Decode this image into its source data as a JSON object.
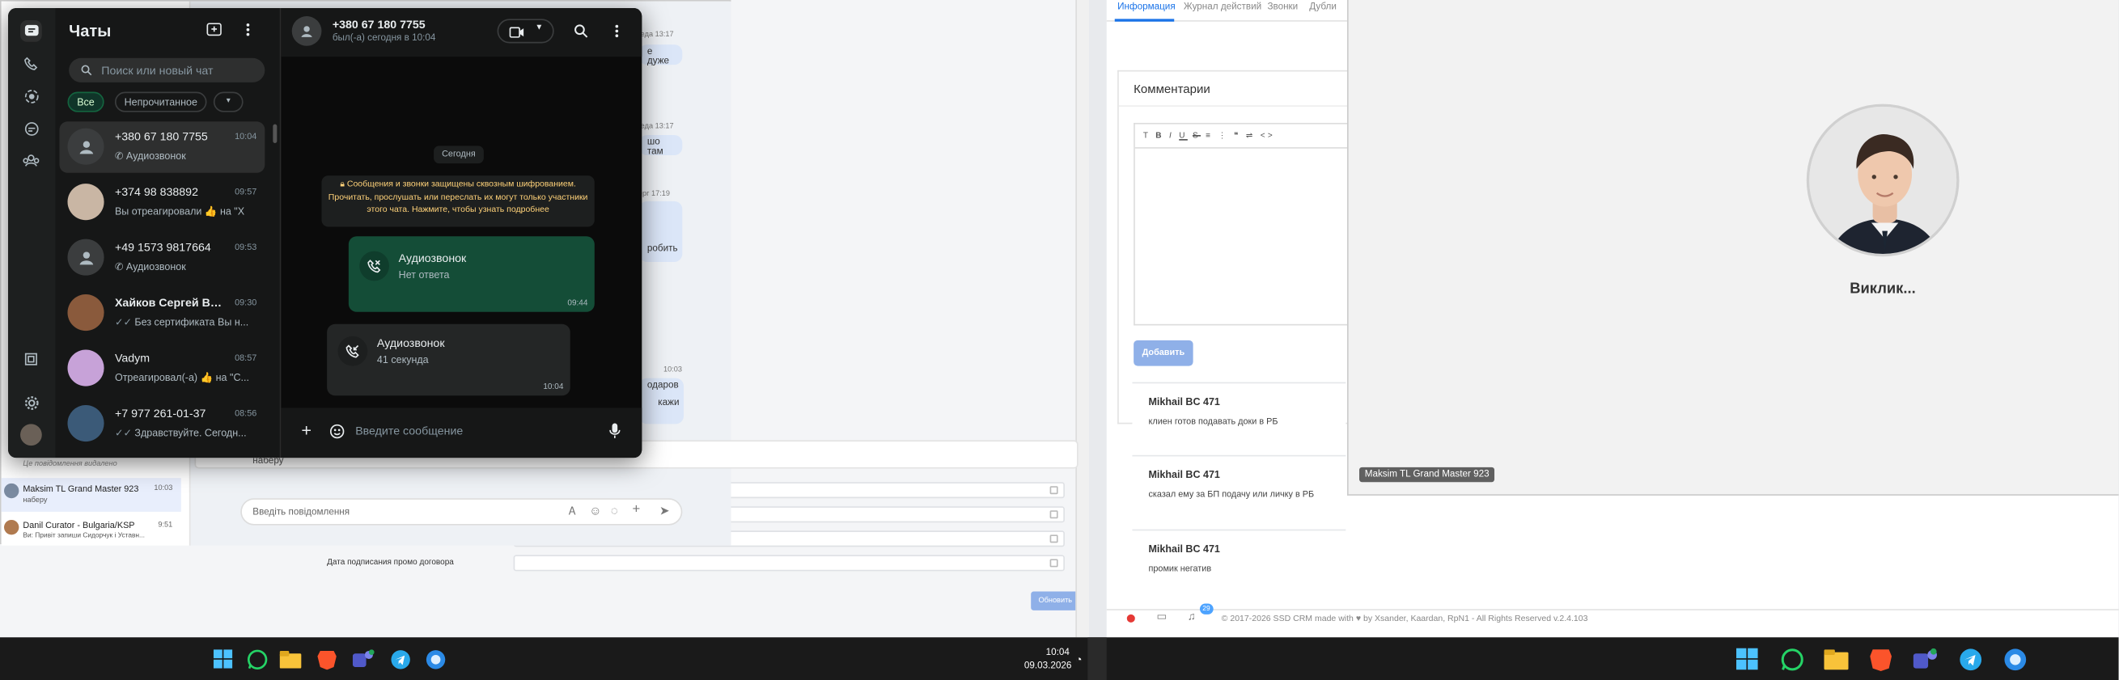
{
  "whatsapp": {
    "header_title": "Чаты",
    "search_placeholder": "Поиск или новый чат",
    "filters": [
      "Все",
      "Непрочитанное"
    ],
    "chats": [
      {
        "name": "+380 67 180 7755",
        "time": "10:04",
        "preview": "Аудиозвонок"
      },
      {
        "name": "+374 98 838892",
        "time": "09:57",
        "preview": "Вы отреагировали 👍 на \"Х"
      },
      {
        "name": "+49 1573 9817664",
        "time": "09:53",
        "preview": "Аудиозвонок"
      },
      {
        "name": "Хайков Сергей Ва...",
        "time": "09:30",
        "preview": "Без сертификата Вы н..."
      },
      {
        "name": "Vadym",
        "time": "08:57",
        "preview": "Отреагировал(-а) 👍 на \"С..."
      },
      {
        "name": "+7 977 261-01-37",
        "time": "08:56",
        "preview": "Здравствуйте. Сегодн..."
      }
    ],
    "chat": {
      "contact": "+380 67 180 7755",
      "status": "был(-а) сегодня в 10:04",
      "date_chip": "Сегодня",
      "encryption_notice": "Сообщения и звонки защищены сквозным шифрованием. Прочитать, прослушать или переслать их могут только участники этого чата. Нажмите, чтобы узнать подробнее",
      "messages": [
        {
          "title": "Аудиозвонок",
          "sub": "Нет ответа",
          "time": "09:44"
        },
        {
          "title": "Аудиозвонок",
          "sub": "41 секунда",
          "time": "10:04"
        }
      ],
      "input_placeholder": "Введите сообщение"
    }
  },
  "telegram": {
    "bubble_times": [
      "реда 13:17",
      "реда 13:17",
      "тверг 17:19",
      "10:03"
    ],
    "bubble_texts": [
      "е дуже",
      "шо там",
      "робить",
      "одаров",
      "кажи"
    ],
    "deleted_note": "Це повідомлення видалено",
    "chats": [
      {
        "name": "Maksim TL Grand Master 923",
        "time": "10:03",
        "preview": "наберу"
      },
      {
        "name": "Danil Curator - Bulgaria/KSP",
        "time": "9:51",
        "preview": "Ви: Привіт запиши Сидорчук і Уставн..."
      }
    ],
    "last_message": "наберу",
    "input_placeholder": "Введіть повідомлення"
  },
  "crm_left": {
    "contract_label": "Дата подписания промо договора",
    "update_button": "Обновить"
  },
  "crm_right": {
    "tabs": [
      "Информация",
      "Журнал действий",
      "Звонки",
      "Дубли"
    ],
    "comments_title": "Комментарии",
    "add_button": "Добавить",
    "comments": [
      {
        "author": "Mikhail BC 471",
        "text": "клиен готов подавать доки в РБ"
      },
      {
        "author": "Mikhail BC 471",
        "text": "сказал ему за БП подачу или личку в РБ"
      },
      {
        "author": "Mikhail BC 471",
        "text": "промик негатив"
      }
    ],
    "footer": "© 2017-2026 SSD CRM made with ♥ by Xsander, Kaardan, RpN1 - All Rights Reserved v.2.4.103",
    "notif_count": "29"
  },
  "video_call": {
    "callee": "Виклик...",
    "caller_tag": "Maksim TL Grand Master 923"
  },
  "taskbar": {
    "time": "10:04",
    "date": "09.03.2026"
  },
  "colors": {
    "wa_green": "#21c063",
    "wa_outgoing": "#144d37",
    "accent_blue": "#1a73e8"
  }
}
